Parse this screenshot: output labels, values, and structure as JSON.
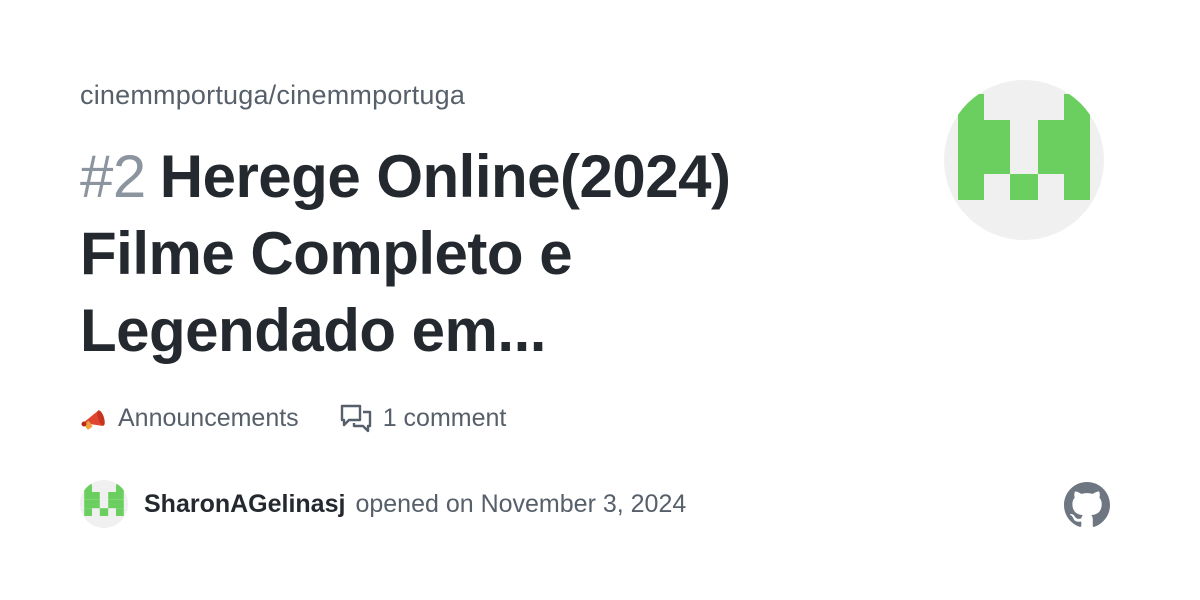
{
  "repo": {
    "path": "cinemmportuga/cinemmportuga"
  },
  "issue": {
    "number": "#2",
    "title": "Herege Online(2024) Filme Completo e Legendado em..."
  },
  "meta": {
    "category_icon": "megaphone-icon",
    "category": "Announcements",
    "comment_icon": "comment-discussion-icon",
    "comments": "1 comment"
  },
  "author": {
    "username": "SharonAGelinasj",
    "opened_text": "opened on November 3, 2024"
  },
  "logo": {
    "icon": "github-logo-icon"
  },
  "colors": {
    "identicon_green": "#6bcf5f",
    "avatar_bg": "#f0f0f0",
    "title_text": "#24292f",
    "muted_text": "#57606a",
    "number_text": "#8c959f",
    "github_logo": "#6e7681"
  }
}
